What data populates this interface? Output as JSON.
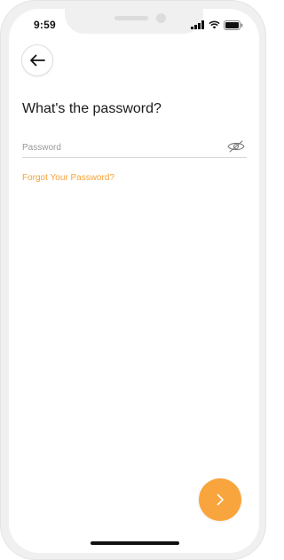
{
  "status_bar": {
    "time": "9:59",
    "icons": [
      "signal-icon",
      "wifi-icon",
      "battery-icon"
    ]
  },
  "header": {
    "back_icon": "arrow-left-icon"
  },
  "title": "What's the password?",
  "password": {
    "placeholder": "Password",
    "value": "",
    "toggle_icon": "eye-off-icon"
  },
  "forgot_link": "Forgot Your Password?",
  "next_button": {
    "icon": "chevron-right-icon"
  },
  "colors": {
    "accent": "#f9a53d",
    "link": "#f6a33a",
    "frame": "#f0f0f0"
  }
}
